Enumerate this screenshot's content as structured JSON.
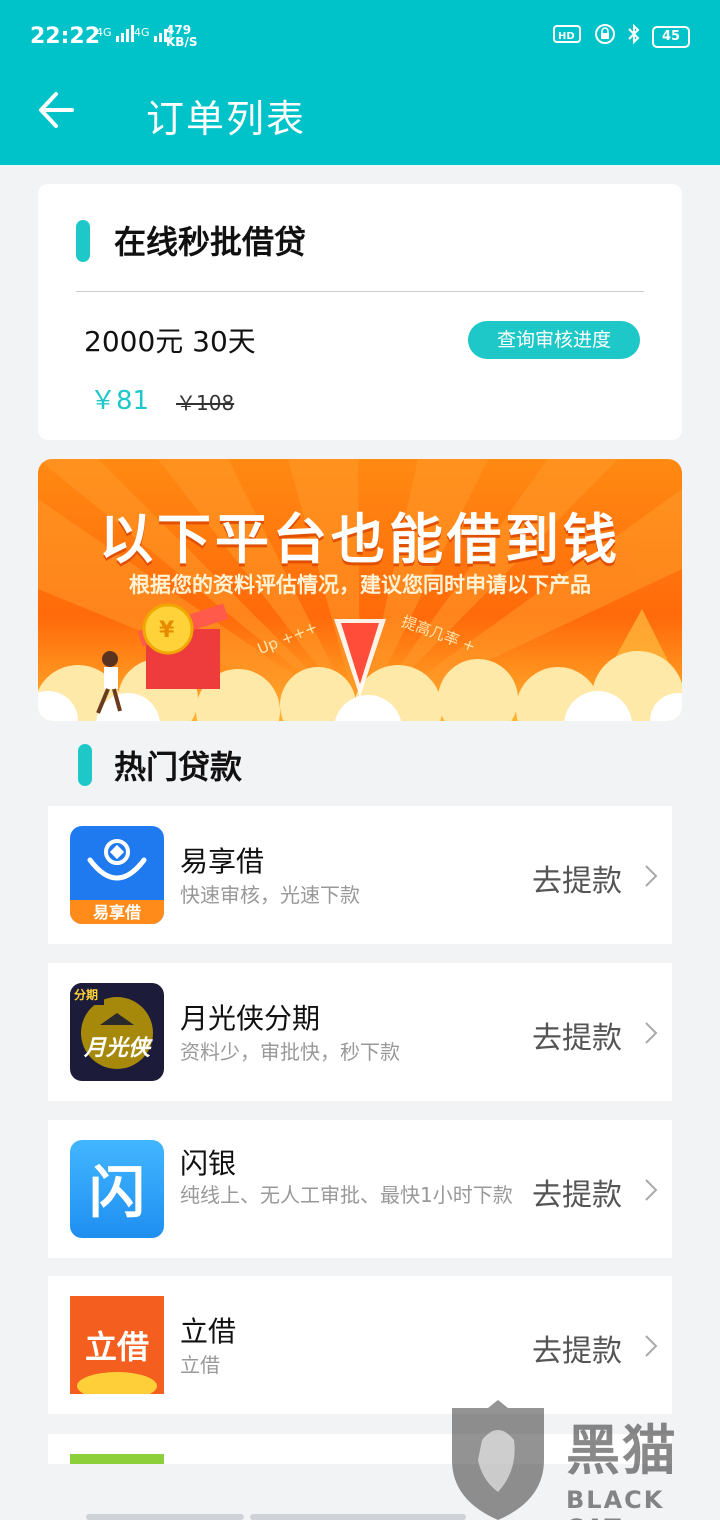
{
  "status_bar": {
    "time": "22:22",
    "net1": "4G",
    "net2": "4G",
    "speed_value": "479",
    "speed_unit": "KB/S",
    "battery": "45"
  },
  "header": {
    "title": "订单列表"
  },
  "order": {
    "title": "在线秒批借贷",
    "amount_term": "2000元 30天",
    "query_button": "查询审核进度",
    "price_now": "￥81",
    "price_old": "￥108"
  },
  "banner": {
    "headline": "以下平台也能借到钱",
    "subline": "根据您的资料评估情况，建议您同时申请以下产品",
    "up_label": "Up +++",
    "rate_label": "提高几率 +"
  },
  "hot_loans": {
    "title": "热门贷款",
    "items": [
      {
        "name": "易享借",
        "desc": "快速审核，光速下款",
        "action": "去提款",
        "logo_text": "易享借"
      },
      {
        "name": "月光侠分期",
        "desc": "资料少，审批快，秒下款",
        "action": "去提款",
        "logo_text": "月光侠",
        "logo_badge": "分期"
      },
      {
        "name": "闪银",
        "desc": "纯线上、无人工审批、最快1小时下款",
        "action": "去提款",
        "logo_text": "闪"
      },
      {
        "name": "立借",
        "desc": "立借",
        "action": "去提款",
        "logo_text": "立借"
      }
    ]
  },
  "watermark": {
    "cn": "黑猫",
    "en": "BLACK CAT"
  },
  "colors": {
    "accent": "#00c3c9",
    "teal": "#1ec8c9",
    "banner_orange": "#ff7a10"
  }
}
